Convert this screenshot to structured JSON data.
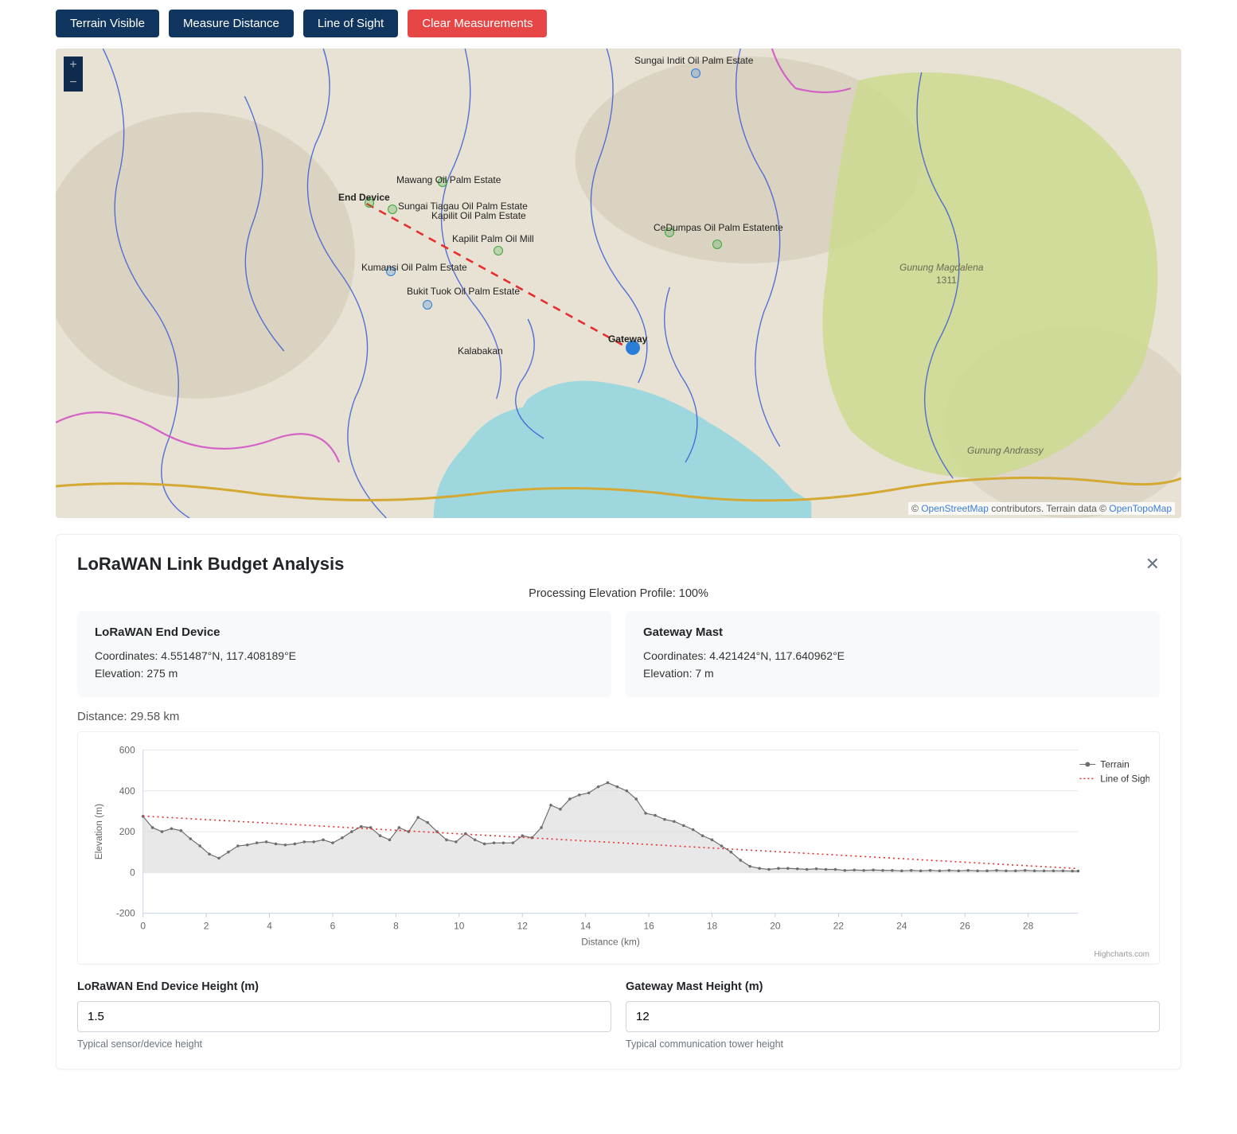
{
  "toolbar": {
    "terrain": "Terrain Visible",
    "measure": "Measure Distance",
    "los": "Line of Sight",
    "clear": "Clear Measurements"
  },
  "map": {
    "zoom_in": "+",
    "zoom_out": "−",
    "markers": {
      "end_device": "End Device",
      "gateway": "Gateway",
      "poi": [
        "Sungai Indit Oil Palm Estate",
        "Mawang Oil Palm Estate",
        "Sungai Tiagau Oil Palm Estate",
        "Kapilit Oil Palm Estate",
        "Kapilit Palm Oil Mill",
        "Kumansi Oil Palm Estate",
        "Bukit Tuok Oil Palm Estate",
        "Kalabakan",
        "CeDumpas Oil Palm Estatente",
        "Gunung Magdalena",
        "1311",
        "Gunung Andrassy"
      ]
    },
    "attribution": {
      "osm_link": "OpenStreetMap",
      "mid_text": " contributors. Terrain data © ",
      "otm_link": "OpenTopoMap"
    }
  },
  "panel": {
    "title": "LoRaWAN Link Budget Analysis",
    "status": "Processing Elevation Profile: 100%",
    "end_device": {
      "title": "LoRaWAN End Device",
      "coords_label": "Coordinates: 4.551487°N, 117.408189°E",
      "elev_label": "Elevation: 275 m"
    },
    "gateway": {
      "title": "Gateway Mast",
      "coords_label": "Coordinates: 4.421424°N, 117.640962°E",
      "elev_label": "Elevation: 7 m"
    },
    "distance": "Distance: 29.58 km",
    "chart_footer": "Highcharts.com",
    "end_device_height": {
      "label": "LoRaWAN End Device Height (m)",
      "value": "1.5",
      "hint": "Typical sensor/device height"
    },
    "gateway_height": {
      "label": "Gateway Mast Height (m)",
      "value": "12",
      "hint": "Typical communication tower height"
    }
  },
  "chart_data": {
    "type": "line",
    "title": "",
    "xlabel": "Distance (km)",
    "ylabel": "Elevation (m)",
    "xlim": [
      0,
      29.58
    ],
    "ylim": [
      -200,
      600
    ],
    "x_ticks": [
      0,
      2,
      4,
      6,
      8,
      10,
      12,
      14,
      16,
      18,
      20,
      22,
      24,
      26,
      28
    ],
    "y_ticks": [
      -200,
      0,
      200,
      400,
      600
    ],
    "series": [
      {
        "name": "Terrain",
        "color": "#6e6e6e",
        "marker": "circle",
        "fill": "#d8d8d8a0",
        "x": [
          0,
          0.3,
          0.6,
          0.9,
          1.2,
          1.5,
          1.8,
          2.1,
          2.4,
          2.7,
          3.0,
          3.3,
          3.6,
          3.9,
          4.2,
          4.5,
          4.8,
          5.1,
          5.4,
          5.7,
          6.0,
          6.3,
          6.6,
          6.9,
          7.2,
          7.5,
          7.8,
          8.1,
          8.4,
          8.7,
          9.0,
          9.3,
          9.6,
          9.9,
          10.2,
          10.5,
          10.8,
          11.1,
          11.4,
          11.7,
          12.0,
          12.3,
          12.6,
          12.9,
          13.2,
          13.5,
          13.8,
          14.1,
          14.4,
          14.7,
          15.0,
          15.3,
          15.6,
          15.9,
          16.2,
          16.5,
          16.8,
          17.1,
          17.4,
          17.7,
          18.0,
          18.3,
          18.6,
          18.9,
          19.2,
          19.5,
          19.8,
          20.1,
          20.4,
          20.7,
          21.0,
          21.3,
          21.6,
          21.9,
          22.2,
          22.5,
          22.8,
          23.1,
          23.4,
          23.7,
          24.0,
          24.3,
          24.6,
          24.9,
          25.2,
          25.5,
          25.8,
          26.1,
          26.4,
          26.7,
          27.0,
          27.3,
          27.6,
          27.9,
          28.2,
          28.5,
          28.8,
          29.1,
          29.4,
          29.58
        ],
        "values": [
          275,
          220,
          200,
          215,
          205,
          165,
          130,
          90,
          70,
          100,
          130,
          135,
          145,
          150,
          140,
          135,
          140,
          150,
          150,
          160,
          145,
          170,
          200,
          225,
          220,
          180,
          160,
          220,
          200,
          270,
          245,
          200,
          160,
          150,
          190,
          160,
          140,
          145,
          145,
          145,
          180,
          170,
          220,
          330,
          310,
          360,
          380,
          390,
          420,
          440,
          420,
          400,
          360,
          290,
          280,
          260,
          250,
          230,
          210,
          180,
          160,
          130,
          100,
          60,
          30,
          20,
          15,
          20,
          20,
          18,
          15,
          18,
          15,
          15,
          10,
          12,
          10,
          12,
          10,
          10,
          8,
          10,
          8,
          10,
          8,
          10,
          8,
          10,
          8,
          8,
          10,
          8,
          8,
          10,
          8,
          8,
          8,
          8,
          7,
          7
        ]
      },
      {
        "name": "Line of Sight",
        "color": "#e62e2e",
        "dash": "dot",
        "x": [
          0,
          29.58
        ],
        "values": [
          276.5,
          19
        ]
      }
    ],
    "legend_position": "right"
  }
}
